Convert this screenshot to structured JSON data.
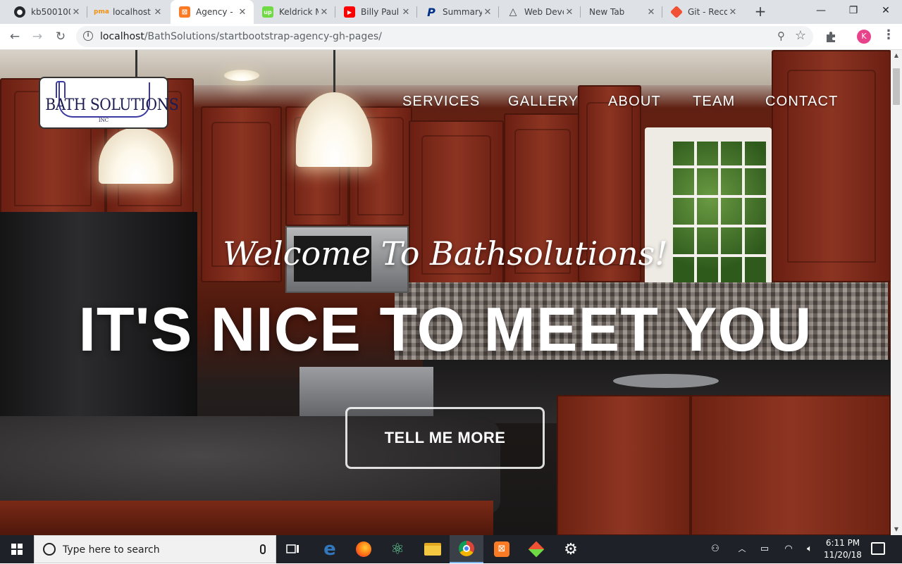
{
  "browser": {
    "tabs": [
      {
        "title": "kb500100",
        "favicon": "github-icon",
        "color": "#24292e"
      },
      {
        "title": "localhost",
        "favicon": "phpmyadmin-icon",
        "color": "#f29111"
      },
      {
        "title": "Agency -",
        "favicon": "xampp-icon",
        "color": "#fb7a24",
        "active": true
      },
      {
        "title": "Keldrick M",
        "favicon": "upwork-icon",
        "color": "#6fda44"
      },
      {
        "title": "Billy Paul",
        "favicon": "youtube-icon",
        "color": "#ff0000"
      },
      {
        "title": "Summary",
        "favicon": "paypal-icon",
        "color": "#003087"
      },
      {
        "title": "Web Deve",
        "favicon": "triangle-logo-icon",
        "color": "#444444"
      },
      {
        "title": "New Tab",
        "favicon": "",
        "color": ""
      },
      {
        "title": "Git - Reco",
        "favicon": "git-icon",
        "color": "#f05033"
      }
    ],
    "new_tab": "+",
    "window_controls": {
      "minimize": "—",
      "restore": "❐",
      "close": "✕"
    },
    "url_host": "localhost",
    "url_path": "/BathSolutions/startbootstrap-agency-gh-pages/",
    "profile_initial": "K"
  },
  "page": {
    "logo": {
      "name": "BATH SOLUTIONS",
      "suffix": "INC"
    },
    "nav": [
      "SERVICES",
      "GALLERY",
      "ABOUT",
      "TEAM",
      "CONTACT"
    ],
    "subheading": "Welcome To Bathsolutions!",
    "heading": "IT'S NICE TO MEET YOU",
    "cta": "TELL ME MORE"
  },
  "taskbar": {
    "search_placeholder": "Type here to search",
    "time": "6:11 PM",
    "date": "11/20/18"
  }
}
